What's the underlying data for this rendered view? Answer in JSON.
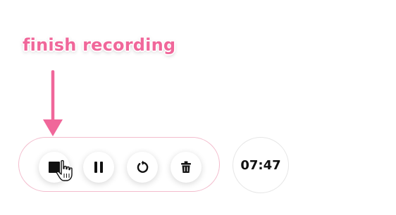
{
  "annotation": {
    "label": "finish recording",
    "color": "#f0679a"
  },
  "toolbar": {
    "border_color": "#f3bccd",
    "buttons": [
      {
        "name": "stop",
        "icon": "stop-square-icon"
      },
      {
        "name": "pause",
        "icon": "pause-icon"
      },
      {
        "name": "restart",
        "icon": "restart-arrow-icon"
      },
      {
        "name": "delete",
        "icon": "trash-icon"
      }
    ]
  },
  "cursor": {
    "icon": "hand-pointer-icon"
  },
  "timer": {
    "value": "07:47"
  }
}
